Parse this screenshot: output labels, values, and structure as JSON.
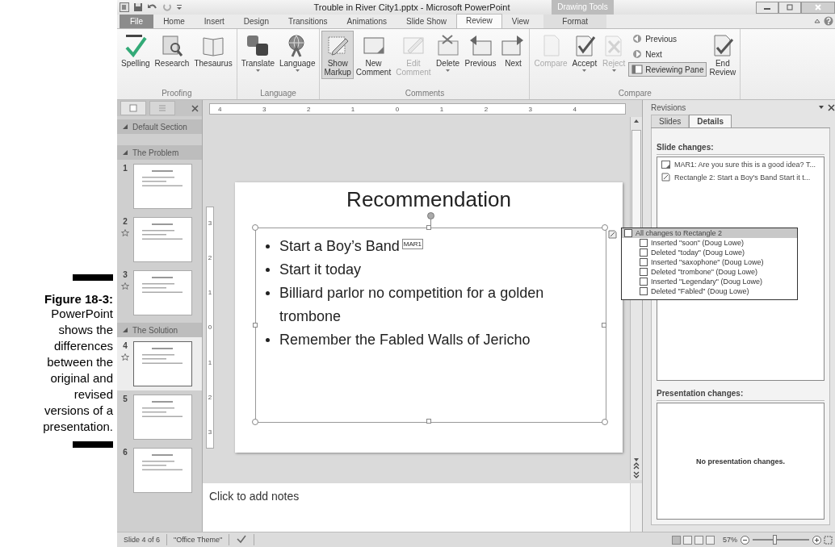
{
  "caption": {
    "label": "Figure 18-3:",
    "text": "PowerPoint shows the differences between the original and revised versions of a presentation."
  },
  "window": {
    "title": "Trouble in River City1.pptx - Microsoft PowerPoint",
    "contextual_group": "Drawing Tools"
  },
  "tabs": [
    {
      "label": "File",
      "kind": "file",
      "selected": false
    },
    {
      "label": "Home",
      "kind": "normal",
      "selected": false
    },
    {
      "label": "Insert",
      "kind": "normal",
      "selected": false
    },
    {
      "label": "Design",
      "kind": "normal",
      "selected": false
    },
    {
      "label": "Transitions",
      "kind": "normal",
      "selected": false
    },
    {
      "label": "Animations",
      "kind": "normal",
      "selected": false
    },
    {
      "label": "Slide Show",
      "kind": "normal",
      "selected": false
    },
    {
      "label": "Review",
      "kind": "normal",
      "selected": true
    },
    {
      "label": "View",
      "kind": "normal",
      "selected": false
    },
    {
      "label": "Format",
      "kind": "contextual",
      "selected": false
    }
  ],
  "ribbon": [
    {
      "label": "Proofing",
      "buttons": [
        {
          "label": "Spelling",
          "kind": "large",
          "dropdown": false,
          "disabled": false,
          "selected": false
        },
        {
          "label": "Research",
          "kind": "large",
          "dropdown": false,
          "disabled": false,
          "selected": false
        },
        {
          "label": "Thesaurus",
          "kind": "large",
          "dropdown": false,
          "disabled": false,
          "selected": false
        }
      ]
    },
    {
      "label": "Language",
      "buttons": [
        {
          "label": "Translate",
          "kind": "large",
          "dropdown": true,
          "disabled": false,
          "selected": false
        },
        {
          "label": "Language",
          "kind": "large",
          "dropdown": true,
          "disabled": false,
          "selected": false
        }
      ]
    },
    {
      "label": "Comments",
      "buttons": [
        {
          "label": "Show\nMarkup",
          "kind": "large",
          "dropdown": false,
          "disabled": false,
          "selected": true
        },
        {
          "label": "New\nComment",
          "kind": "large",
          "dropdown": false,
          "disabled": false,
          "selected": false
        },
        {
          "label": "Edit\nComment",
          "kind": "large",
          "dropdown": false,
          "disabled": true,
          "selected": false
        },
        {
          "label": "Delete",
          "kind": "large",
          "dropdown": true,
          "disabled": false,
          "selected": false
        },
        {
          "label": "Previous",
          "kind": "large",
          "dropdown": false,
          "disabled": false,
          "selected": false
        },
        {
          "label": "Next",
          "kind": "large",
          "dropdown": false,
          "disabled": false,
          "selected": false
        }
      ]
    },
    {
      "label": "Compare",
      "buttons": [
        {
          "label": "Compare",
          "kind": "large",
          "dropdown": false,
          "disabled": true,
          "selected": false
        },
        {
          "label": "Accept",
          "kind": "large",
          "dropdown": true,
          "disabled": false,
          "selected": false
        },
        {
          "label": "Reject",
          "kind": "large",
          "dropdown": true,
          "disabled": true,
          "selected": false
        },
        {
          "label": "Previous",
          "kind": "small",
          "disabled": false,
          "selected": false
        },
        {
          "label": "Next",
          "kind": "small",
          "disabled": false,
          "selected": false
        },
        {
          "label": "Reviewing Pane",
          "kind": "small",
          "disabled": false,
          "selected": true
        },
        {
          "label": "End\nReview",
          "kind": "large",
          "dropdown": false,
          "disabled": false,
          "selected": false
        }
      ]
    }
  ],
  "sections": [
    {
      "title": "Default Section",
      "expanded": true
    },
    {
      "title": "The Problem",
      "expanded": true,
      "slides": [
        {
          "number": "1",
          "has_comments": false,
          "selected": false
        },
        {
          "number": "2",
          "has_comments": true,
          "selected": false
        },
        {
          "number": "3",
          "has_comments": true,
          "selected": false
        }
      ]
    },
    {
      "title": "The Solution",
      "expanded": true,
      "slides": [
        {
          "number": "4",
          "has_comments": true,
          "selected": true
        },
        {
          "number": "5",
          "has_comments": false,
          "selected": false
        },
        {
          "number": "6",
          "has_comments": false,
          "selected": false
        }
      ]
    }
  ],
  "ruler": {
    "horizontal": [
      "4",
      "3",
      "2",
      "1",
      "0",
      "1",
      "2",
      "3",
      "4"
    ],
    "vertical": [
      "3",
      "2",
      "1",
      "0",
      "1",
      "2",
      "3"
    ]
  },
  "slide": {
    "title": "Recommendation",
    "bullets": [
      "Start a Boy’s Band",
      "Start it today",
      "Billiard parlor no competition for a golden trombone",
      "Remember the Fabled Walls of Jericho"
    ],
    "comment_marker": "MAR1"
  },
  "change_popup": {
    "header": {
      "label": "All changes to Rectangle 2",
      "checked": false
    },
    "items": [
      {
        "label": "Inserted \"soon\" (Doug Lowe)",
        "checked": false
      },
      {
        "label": "Deleted \"today\" (Doug Lowe)",
        "checked": false
      },
      {
        "label": "Inserted \"saxophone\" (Doug Lowe)",
        "checked": false
      },
      {
        "label": "Deleted \"trombone\" (Doug Lowe)",
        "checked": false
      },
      {
        "label": "Inserted \"Legendary\" (Doug Lowe)",
        "checked": false
      },
      {
        "label": "Deleted \"Fabled\" (Doug Lowe)",
        "checked": false
      }
    ]
  },
  "notes": {
    "placeholder": "Click to add notes"
  },
  "revisions": {
    "title": "Revisions",
    "tabs": [
      {
        "label": "Slides",
        "selected": false
      },
      {
        "label": "Details",
        "selected": true
      }
    ],
    "slide_changes": {
      "heading": "Slide changes:",
      "items": [
        {
          "kind": "comment",
          "text": "MAR1: Are you sure this is a good idea? T..."
        },
        {
          "kind": "shape",
          "text": "Rectangle 2: Start a Boy's Band Start it t..."
        }
      ]
    },
    "presentation_changes": {
      "heading": "Presentation changes:",
      "text": "No presentation changes."
    }
  },
  "status_bar": {
    "slide": "Slide 4 of 6",
    "theme": "\"Office Theme\"",
    "views": [
      {
        "selected": true
      },
      {
        "selected": false
      },
      {
        "selected": false
      },
      {
        "selected": false
      }
    ],
    "zoom": "57%",
    "zoom_slider": {
      "level": 0.4
    }
  }
}
